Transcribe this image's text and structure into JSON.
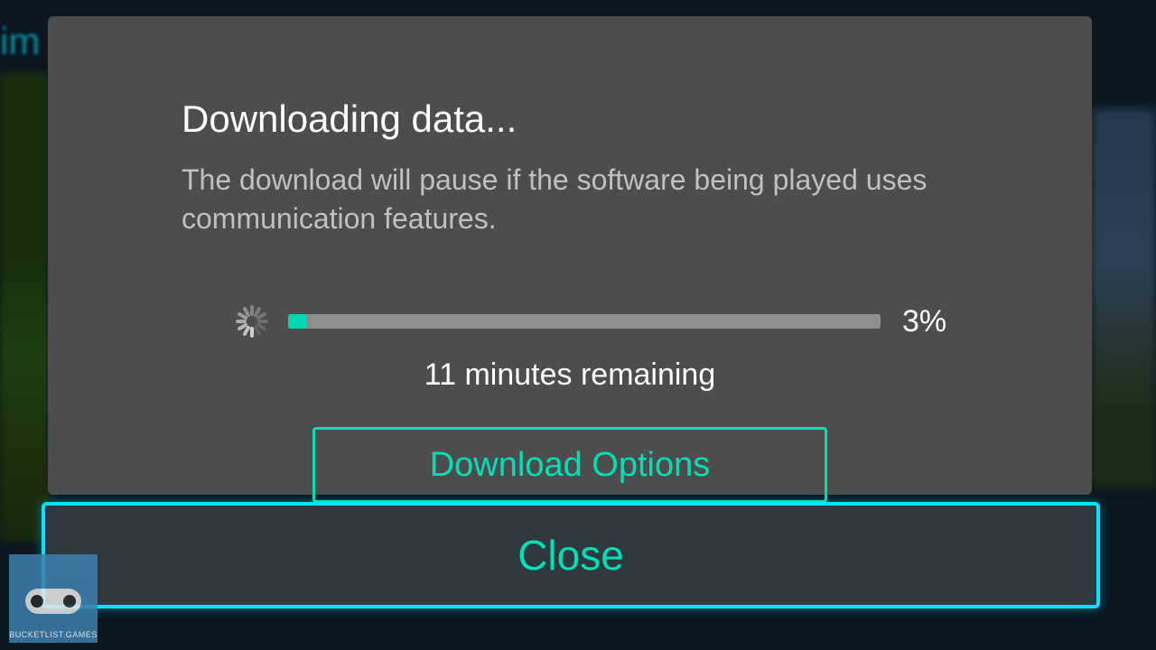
{
  "background": {
    "tab_text_fragment": "im"
  },
  "dialog": {
    "title": "Downloading data...",
    "subtitle": "The download will pause if the software being played uses communication features.",
    "progress": {
      "percent_value": 3,
      "percent_label": "3%",
      "bar_fill_width_percent": 3,
      "remaining_text": "11 minutes remaining"
    },
    "options_button_label": "Download Options",
    "close_button_label": "Close"
  },
  "watermark": {
    "text": "BUCKETLIST.GAMES"
  },
  "colors": {
    "dialog_bg": "#4d4d4d",
    "accent_teal": "#00e0b8",
    "focus_cyan": "#00e5ff",
    "close_bg": "#2f383d"
  }
}
